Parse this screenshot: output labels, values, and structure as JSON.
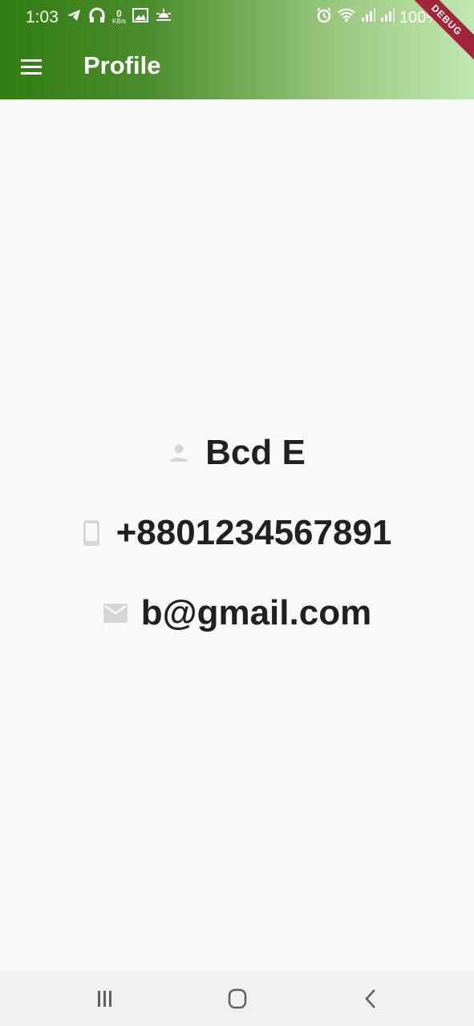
{
  "status_bar": {
    "time": "1:03",
    "net_speed_value": "0",
    "net_speed_unit": "KB/s",
    "battery_text": "100%"
  },
  "app_bar": {
    "title": "Profile",
    "debug_banner": "DEBUG",
    "menu_icon": "hamburger-menu-icon"
  },
  "profile": {
    "name": "Bcd E",
    "phone": "+8801234567891",
    "email": "b@gmail.com",
    "name_icon": "person-icon",
    "phone_icon": "phone-icon",
    "email_icon": "mail-icon"
  },
  "nav_bar": {
    "recents_icon": "recents-icon",
    "home_icon": "home-icon",
    "back_icon": "back-icon"
  },
  "colors": {
    "appbar_start": "#2f7d10",
    "appbar_end": "#c0e8b0",
    "text": "#212121",
    "icon_gray": "#d6d6d6",
    "background": "#fafafa"
  }
}
